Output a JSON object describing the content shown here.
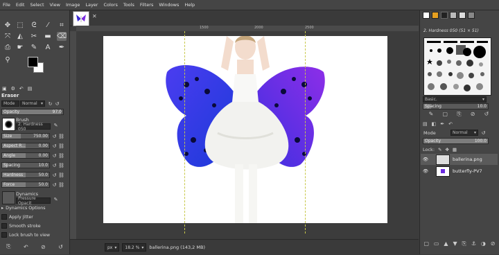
{
  "menubar": {
    "items": [
      "File",
      "Edit",
      "Select",
      "View",
      "Image",
      "Layer",
      "Colors",
      "Tools",
      "Filters",
      "Windows",
      "Help"
    ]
  },
  "toolbox": {
    "tools": [
      "move-tool-icon",
      "rect-select-icon",
      "lasso-icon",
      "fuzzy-select-icon",
      "crop-icon",
      "transform-icon",
      "warp-icon",
      "scissors-icon",
      "paintbrush-icon",
      "clone-icon",
      "smudge-icon",
      "text-icon",
      "color-picker-icon",
      "path-icon",
      "eraser-icon",
      "magnify-icon"
    ]
  },
  "tool_options": {
    "title": "Eraser",
    "mode_label": "Mode",
    "mode_value": "Normal",
    "opacity_label": "Opacity",
    "opacity_value": "97.0",
    "opacity_fraction": 0.97,
    "brush_label": "Brush",
    "brush_value": "2. Hardness 050",
    "size_label": "Size",
    "size_value": "750.00",
    "aspect_label": "Aspect R...",
    "aspect_value": "0.00",
    "angle_label": "Angle",
    "angle_value": "0.00",
    "spacing_label": "Spacing",
    "spacing_value": "10.0",
    "hardness_label": "Hardness",
    "hardness_value": "50.0",
    "force_label": "Force",
    "force_value": "50.0",
    "dynamics_label": "Dynamics",
    "dynamics_value": "Pressure Opacit",
    "dynamics_options": "Dynamics Options",
    "apply_jitter": "Apply Jitter",
    "smooth_stroke": "Smooth stroke",
    "lock_brush": "Lock brush to view"
  },
  "statusbar": {
    "unit": "px",
    "zoom": "18.2 %",
    "file_info": "ballerina.png (143,2 MB)"
  },
  "ruler": {
    "ticks": [
      "1500",
      "2000",
      "2500"
    ]
  },
  "brushes_panel": {
    "title": "2. Hardness 050 (51 × 51)",
    "preset": "Basic.",
    "spacing_label": "Spacing",
    "spacing_value": "10.0"
  },
  "layers_panel": {
    "mode_label": "Mode",
    "mode_value": "Normal",
    "opacity_label": "Opacity",
    "opacity_value": "100.0",
    "lock_label": "Lock:",
    "layers": [
      {
        "name": "ballerina.png"
      },
      {
        "name": "butterfly-PV7"
      }
    ]
  },
  "colors": {
    "wing_blue": "#2a2ad8",
    "wing_violet": "#7a1ee0",
    "guide_yellow": "#c8c84a"
  }
}
